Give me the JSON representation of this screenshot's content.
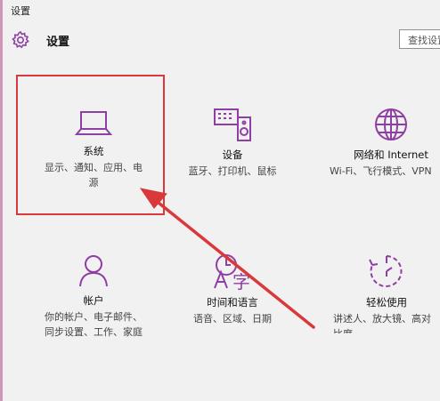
{
  "window": {
    "title": "设置"
  },
  "header": {
    "title": "设置",
    "icon": "gear-icon"
  },
  "search": {
    "placeholder": "查找设置"
  },
  "accent_color": "#8e3fa3",
  "highlight_color": "#d9393b",
  "tiles": [
    {
      "name": "系统",
      "desc_line1": "显示、通知、应用、电",
      "desc_line2": "源",
      "icon": "laptop-icon"
    },
    {
      "name": "设备",
      "desc_line1": "蓝牙、打印机、鼠标",
      "icon": "devices-icon"
    },
    {
      "name": "网络和 Internet",
      "desc_line1": "Wi-Fi、飞行模式、VPN",
      "icon": "globe-icon"
    },
    {
      "name": "帐户",
      "desc_line1": "你的帐户、电子邮件、",
      "desc_line2": "同步设置、工作、家庭",
      "icon": "person-icon"
    },
    {
      "name": "时间和语言",
      "desc_line1": "语音、区域、日期",
      "icon": "time-language-icon"
    },
    {
      "name": "轻松使用",
      "desc_line1": "讲述人、放大镜、高对",
      "desc_line2": "比度",
      "icon": "ease-of-access-icon"
    }
  ]
}
